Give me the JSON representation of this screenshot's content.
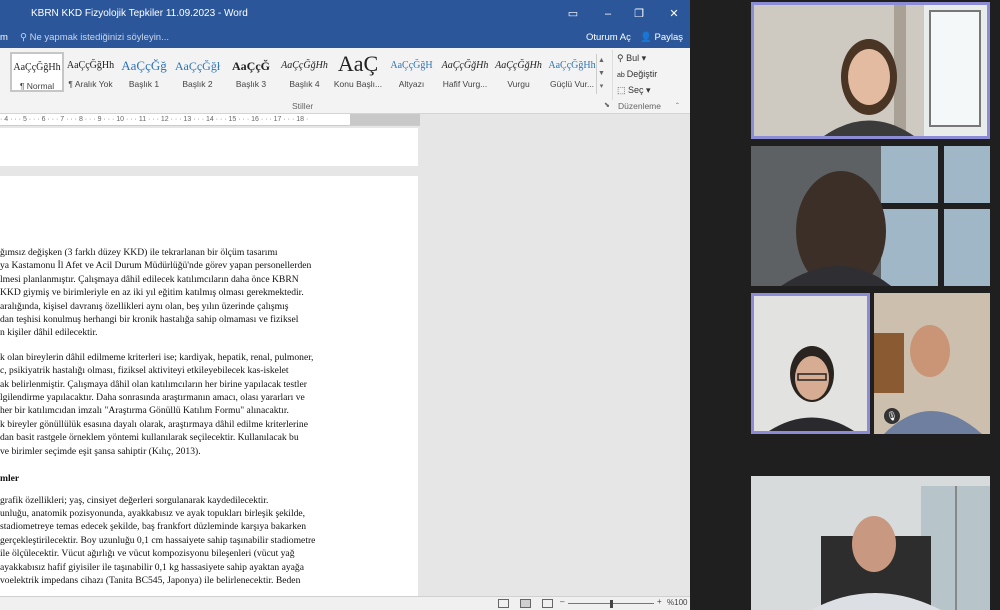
{
  "word": {
    "title": "KBRN KKD Fizyolojik Tepkiler 11.09.2023 - Word",
    "menu_partial": "m",
    "tell_me": "Ne yapmak istediğinizi söyleyin...",
    "sign_in": "Oturum Aç",
    "share": "Paylaş",
    "styles": [
      {
        "sample": "AaÇçĞğHh",
        "name": "¶ Normal"
      },
      {
        "sample": "AaÇçĞğHh",
        "name": "¶ Aralık Yok"
      },
      {
        "sample": "AaÇçĞğ",
        "name": "Başlık 1"
      },
      {
        "sample": "AaÇçĞğł",
        "name": "Başlık 2"
      },
      {
        "sample": "AaÇçĞ",
        "name": "Başlık 3"
      },
      {
        "sample": "AaÇçĞğHh",
        "name": "Başlık 4"
      },
      {
        "sample": "AaÇ",
        "name": "Konu Başlı..."
      },
      {
        "sample": "AaÇçĞğH",
        "name": "Altyazı"
      },
      {
        "sample": "AaÇçĞğHh",
        "name": "Hafif Vurg..."
      },
      {
        "sample": "AaÇçĞğHh",
        "name": "Vurgu"
      },
      {
        "sample": "AaÇçĞğHh",
        "name": "Güçlü Vur..."
      }
    ],
    "styles_group_label": "Stiller",
    "editing_group_label": "Düzenleme",
    "editing": {
      "find": "Bul",
      "replace": "Değiştir",
      "select": "Seç"
    },
    "ruler_text": "· 4 · · · 5 · · · 6 · · · 7 · · · 8 · · · 9 · · · 10 · · · 11 · · · 12 · · · 13 · · · 14 · · · 15 · · · 16 · · · 17 · · · 18 ·",
    "doc_lines_1": [
      "ğımsız değişken (3 farklı düzey KKD) ile tekrarlanan bir ölçüm tasarımı",
      "ya Kastamonu İl Afet ve Acil Durum Müdürlüğü'nde görev yapan personellerden",
      "lmesi planlanmıştır. Çalışmaya dâhil edilecek katılımcıların daha önce KBRN",
      "KKD giymiş ve birimleriyle en az iki yıl eğitim katılmış olması gerekmektedir.",
      "aralığında, kişisel davranış özellikleri aynı olan, beş yılın üzerinde çalışmış",
      "dan teşhisi konulmuş herhangi bir kronik hastalığa sahip olmaması ve fiziksel",
      "n kişiler dâhil edilecektir."
    ],
    "doc_lines_2": [
      "k olan bireylerin dâhil edilmeme kriterleri ise; kardiyak, hepatik, renal, pulmoner,",
      "c, psikiyatrik hastalığı olması, fiziksel aktiviteyi etkileyebilecek kas-iskelet",
      "ak belirlenmiştir. Çalışmaya dâhil olan katılımcıların her birine yapılacak testler",
      "lgilendirme yapılacaktır. Daha sonrasında araştırmanın amacı, olası yararları ve",
      "her bir katılımcıdan imzalı \"Araştırma Gönüllü Katılım Formu\" alınacaktır.",
      "k bireyler gönüllülük esasına dayalı olarak, araştırmaya dâhil edilme kriterlerine",
      "dan basit rastgele örneklem yöntemi kullanılarak seçilecektir. Kullanılacak bu",
      "ve birimler seçimde eşit şansa sahiptir (Kılıç, 2013)."
    ],
    "heading_partial": "mler",
    "doc_lines_3": [
      "grafik özellikleri; yaş, cinsiyet değerleri sorgulanarak kaydedilecektir.",
      "unluğu, anatomik pozisyonunda, ayakkabısız ve ayak topukları birleşik şekilde,",
      "stadiometreye temas edecek şekilde, baş frankfort düzleminde karşıya bakarken",
      "gerçekleştirilecektir. Boy uzunluğu 0,1 cm hassaiyete sahip taşınabilir stadiometre",
      "ile ölçülecektir. Vücut ağırlığı ve vücut kompozisyonu bileşenleri (vücut yağ",
      "ayakkabısız hafif giyisiler ile taşınabilir 0,1 kg hassasiyete sahip ayaktan ayağa",
      "voelektrik impedans cihazı (Tanita BC545, Japonya) ile belirlenecektir. Beden"
    ],
    "zoom": "%100",
    "zoom_level_fraction": 0.5
  },
  "meeting": {
    "colors": {
      "active_border": "#8b8bd6",
      "background": "#1f1f1f"
    },
    "tiles": [
      {
        "id": "participant-1",
        "active": true,
        "muted": false
      },
      {
        "id": "participant-2",
        "active": false,
        "muted": false
      },
      {
        "id": "participant-3",
        "active": true,
        "muted": false
      },
      {
        "id": "participant-4",
        "active": false,
        "muted": true
      },
      {
        "id": "participant-5",
        "active": false,
        "muted": false
      }
    ]
  }
}
